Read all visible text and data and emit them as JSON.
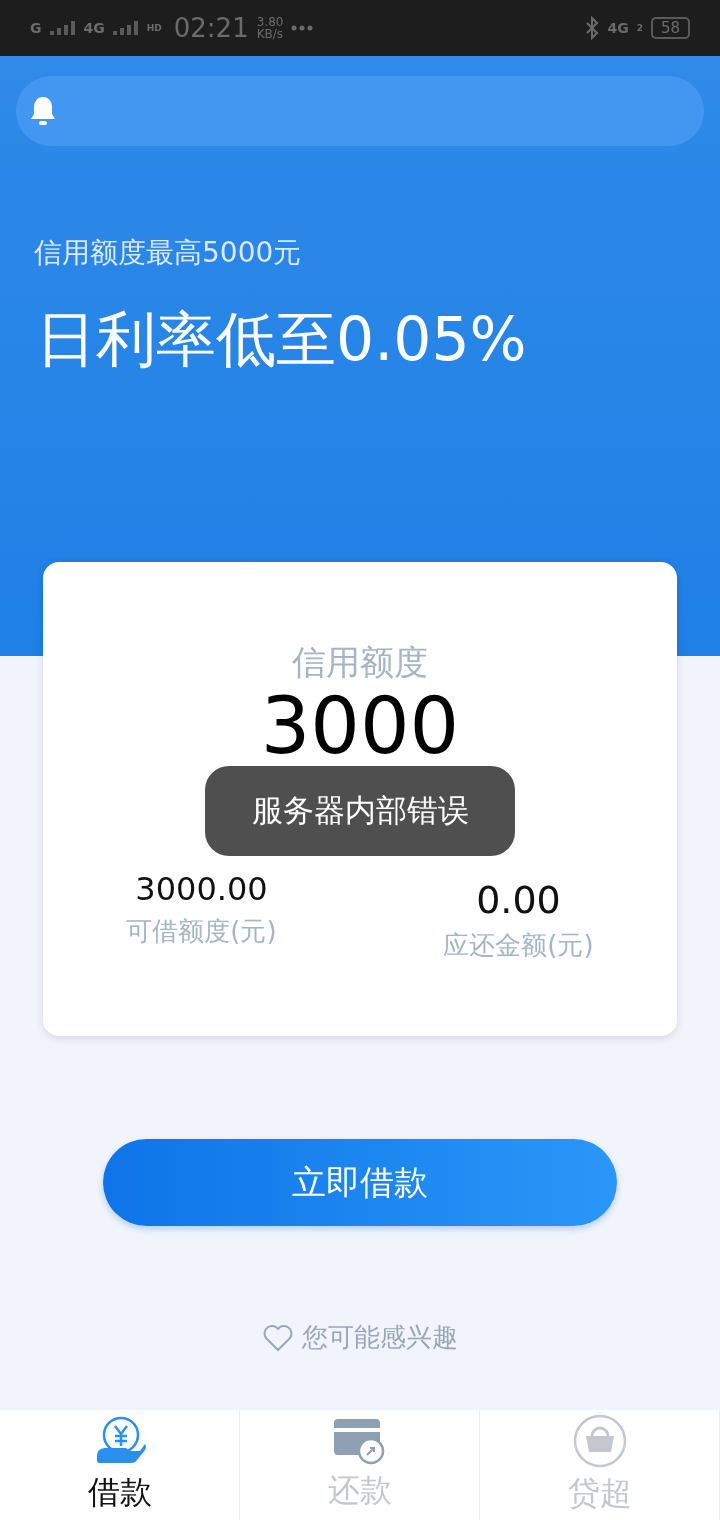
{
  "status_bar": {
    "signal_labels": [
      "G",
      "4G"
    ],
    "hd_badge": "HD",
    "time": "02:21",
    "speed": "3.80",
    "speed_unit": "KB/s",
    "network": "4G",
    "sim_index": "2",
    "battery": "58"
  },
  "banner": {
    "subtitle": "信用额度最高5000元",
    "headline": "日利率低至0.05%"
  },
  "credit_card": {
    "title": "信用额度",
    "amount": "3000",
    "stats": [
      {
        "value": "3000.00",
        "label": "可借额度(元)"
      },
      {
        "value": "0.00",
        "label": "应还金额(元)"
      }
    ]
  },
  "toast": "服务器内部错误",
  "primary_button": "立即借款",
  "interest_link": "您可能感兴趣",
  "tabs": [
    {
      "kind": "loan",
      "label": "借款",
      "selected": true
    },
    {
      "kind": "repay",
      "label": "还款",
      "selected": false
    },
    {
      "kind": "market",
      "label": "贷超",
      "selected": false
    }
  ]
}
